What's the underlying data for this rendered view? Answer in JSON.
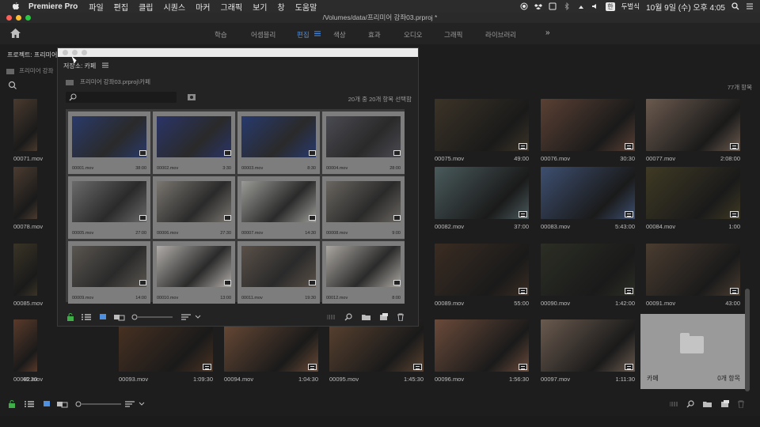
{
  "menubar": {
    "app_name": "Premiere Pro",
    "menus": [
      "파일",
      "편집",
      "클립",
      "시퀀스",
      "마커",
      "그래픽",
      "보기",
      "창",
      "도움말"
    ],
    "input_method": "한",
    "input_label": "두벌식",
    "clock": "10월 9일 (수) 오후 4:05"
  },
  "window": {
    "title": "/Volumes/data/프리미어 강좌03.prproj *"
  },
  "workspaces": {
    "tabs": [
      "학습",
      "어셈블리",
      "편집",
      "색상",
      "효과",
      "오디오",
      "그래픽",
      "라이브러리"
    ],
    "active": "편집",
    "more": "»"
  },
  "project_panel": {
    "tab": "프로젝트: 프리미어",
    "subpath": "프리미어 강좌",
    "items_count": "77개 항목"
  },
  "main_clips": [
    {
      "name": "00071.mov",
      "duration": ""
    },
    {
      "name": "00075.mov",
      "duration": "49:00"
    },
    {
      "name": "00076.mov",
      "duration": "30:30"
    },
    {
      "name": "00077.mov",
      "duration": "2:08:00"
    },
    {
      "name": "00078.mov",
      "duration": ""
    },
    {
      "name": "00082.mov",
      "duration": "37:00"
    },
    {
      "name": "00083.mov",
      "duration": "5:43:00"
    },
    {
      "name": "00084.mov",
      "duration": "1:00"
    },
    {
      "name": "00085.mov",
      "duration": ""
    },
    {
      "name": "00089.mov",
      "duration": "55:00"
    },
    {
      "name": "00090.mov",
      "duration": "1:42:00"
    },
    {
      "name": "00091.mov",
      "duration": "43:00"
    },
    {
      "name": "00092.mov",
      "duration": "46:30"
    },
    {
      "name": "00093.mov",
      "duration": "1:09:30"
    },
    {
      "name": "00094.mov",
      "duration": "1:04:30"
    },
    {
      "name": "00095.mov",
      "duration": "1:45:30"
    },
    {
      "name": "00096.mov",
      "duration": "1:56:30"
    },
    {
      "name": "00097.mov",
      "duration": "1:11:30"
    }
  ],
  "folder": {
    "name": "카페",
    "count": "0개 항목"
  },
  "bin_window": {
    "header": "저장소: 카페",
    "path": "프리미어 강좌03.prproj\\카페",
    "selection": "20개 중 20개 항목 선택함",
    "clips": [
      {
        "name": "00001.mov",
        "duration": "38:00"
      },
      {
        "name": "00002.mov",
        "duration": "3:30"
      },
      {
        "name": "00003.mov",
        "duration": "8:30"
      },
      {
        "name": "00004.mov",
        "duration": "28:00"
      },
      {
        "name": "00005.mov",
        "duration": "27:00"
      },
      {
        "name": "00006.mov",
        "duration": "27:30"
      },
      {
        "name": "00007.mov",
        "duration": "14:30"
      },
      {
        "name": "00008.mov",
        "duration": "9:00"
      },
      {
        "name": "00009.mov",
        "duration": "14:00"
      },
      {
        "name": "00010.mov",
        "duration": "13:00"
      },
      {
        "name": "00011.mov",
        "duration": "19:30"
      },
      {
        "name": "00012.mov",
        "duration": "8:00"
      }
    ]
  },
  "colors": {
    "accent": "#4f8fe0",
    "background": "#1d1d1d",
    "selected_tile": "#7d7d7d"
  }
}
